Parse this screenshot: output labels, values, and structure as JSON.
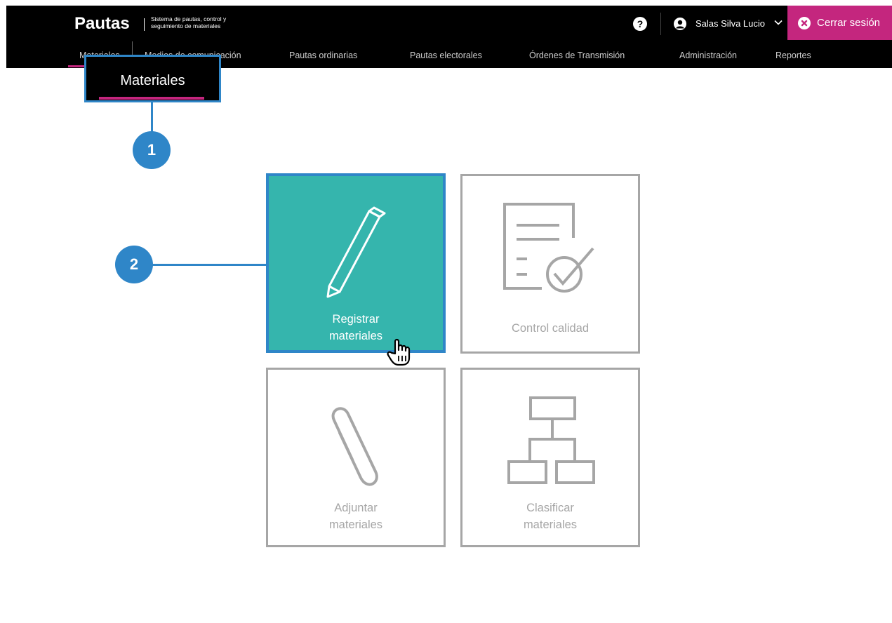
{
  "header": {
    "brand": "Pautas",
    "subtitle_line1": "Sistema de pautas, control y",
    "subtitle_line2": "seguimiento de materiales",
    "help_glyph": "?",
    "user_name": "Salas Silva Lucio",
    "logout_label": "Cerrar sesión",
    "logout_color": "#c4267e"
  },
  "nav": {
    "items": [
      {
        "label": "Materiales"
      },
      {
        "label": "Medios de comunicación"
      },
      {
        "label": "Pautas ordinarias"
      },
      {
        "label": "Pautas electorales"
      },
      {
        "label": "Órdenes de Transmisión"
      },
      {
        "label": "Administración"
      },
      {
        "label": "Reportes"
      }
    ]
  },
  "callout": {
    "label": "Materiales",
    "step1": "1",
    "step2": "2",
    "color": "#2f86c8"
  },
  "tiles": [
    {
      "line1": "Registrar",
      "line2": "materiales",
      "icon": "pencil-icon",
      "active": true,
      "color": "#35b5ad"
    },
    {
      "line1": "Control calidad",
      "line2": "",
      "icon": "document-check-icon",
      "active": false
    },
    {
      "line1": "Adjuntar",
      "line2": "materiales",
      "icon": "paperclip-icon",
      "active": false
    },
    {
      "line1": "Clasificar",
      "line2": "materiales",
      "icon": "hierarchy-icon",
      "active": false
    }
  ]
}
